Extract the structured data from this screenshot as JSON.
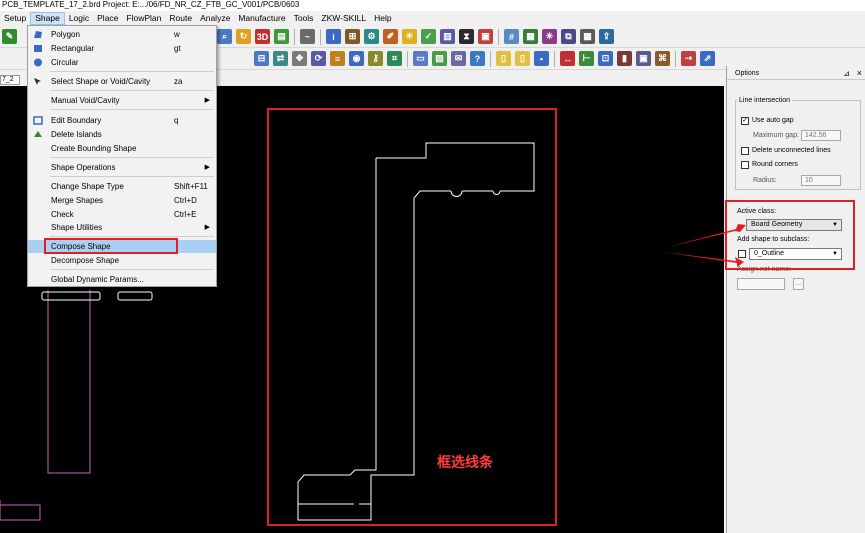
{
  "window": {
    "title": "PCB_TEMPLATE_17_2.brd  Project: E:.../06/FD_NR_CZ_FTB_GC_V001/PCB/0603"
  },
  "menu": [
    "Setup",
    "Shape",
    "Logic",
    "Place",
    "FlowPlan",
    "Route",
    "Analyze",
    "Manufacture",
    "Tools",
    "ZKW-SKILL",
    "Help"
  ],
  "document_tab": "7_2",
  "shape_menu": {
    "polygon": {
      "label": "Polygon",
      "shortcut": "w"
    },
    "rectangular": {
      "label": "Rectangular",
      "shortcut": "gt"
    },
    "circular": {
      "label": "Circular"
    },
    "select_shape": {
      "label": "Select Shape or Void/Cavity",
      "shortcut": "za"
    },
    "manual_void": {
      "label": "Manual Void/Cavity"
    },
    "edit_boundary": {
      "label": "Edit Boundary",
      "shortcut": "q"
    },
    "delete_islands": {
      "label": "Delete Islands"
    },
    "bounding_shape": {
      "label": "Create Bounding Shape"
    },
    "shape_operations": {
      "label": "Shape Operations"
    },
    "change_type": {
      "label": "Change Shape Type",
      "shortcut": "Shift+F11"
    },
    "merge": {
      "label": "Merge Shapes",
      "shortcut": "Ctrl+D"
    },
    "check": {
      "label": "Check",
      "shortcut": "Ctrl+E"
    },
    "utilities": {
      "label": "Shape Utilities"
    },
    "compose": {
      "label": "Compose Shape"
    },
    "decompose": {
      "label": "Decompose Shape"
    },
    "global_params": {
      "label": "Global Dynamic Params..."
    }
  },
  "annotation": {
    "text": "框选线条"
  },
  "options_panel": {
    "title": "Options",
    "line_intersection": {
      "title": "Line intersection",
      "use_auto_gap": {
        "label": "Use auto gap",
        "checked": true
      },
      "max_gap_label": "Maximum gap:",
      "max_gap_value": "142.56",
      "delete_unconnected": {
        "label": "Delete unconnected lines",
        "checked": false
      },
      "round_corners": {
        "label": "Round corners",
        "checked": false
      },
      "radius_label": "Radius:",
      "radius_value": "10"
    },
    "active_class_label": "Active class:",
    "active_class_value": "Board Geometry",
    "add_to_subclass_label": "Add shape to subclass:",
    "subclass_value": "0_Outline",
    "assign_net_label": "Assign net name:",
    "assign_net_value": "",
    "browse_label": "..."
  },
  "colors": {
    "annotation_red": "#e02020",
    "outline_pink": "#d060c0",
    "canvas": "#000000",
    "highlight": "#a9cff2"
  }
}
